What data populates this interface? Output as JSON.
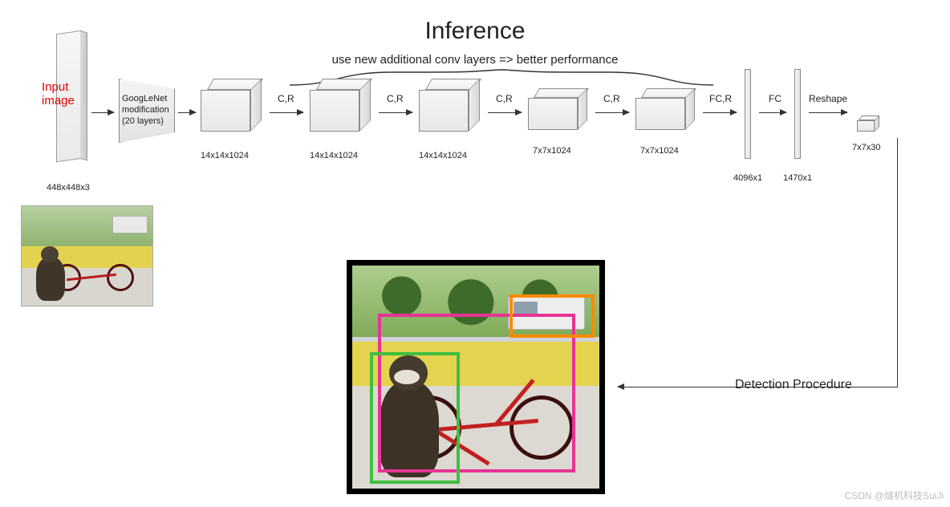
{
  "title": "Inference",
  "subtitle": "use new additional conv layers => better performance",
  "input_label_l1": "Input",
  "input_label_l2": "image",
  "input_dim": "448x448x3",
  "backbone_l1": "GoogLeNet",
  "backbone_l2": "modification",
  "backbone_l3": "(20 layers)",
  "blocks": {
    "b1": "14x14x1024",
    "b2": "14x14x1024",
    "b3": "14x14x1024",
    "b4": "7x7x1024",
    "b5": "7x7x1024"
  },
  "ops": {
    "cr": "C,R",
    "fcr": "FC,R",
    "fc": "FC",
    "reshape": "Reshape"
  },
  "fc1": "4096x1",
  "fc2": "1470x1",
  "out": "7x7x30",
  "detection_label": "Detection Procedure",
  "watermark": "CSDN @燧机科技SuiJi"
}
